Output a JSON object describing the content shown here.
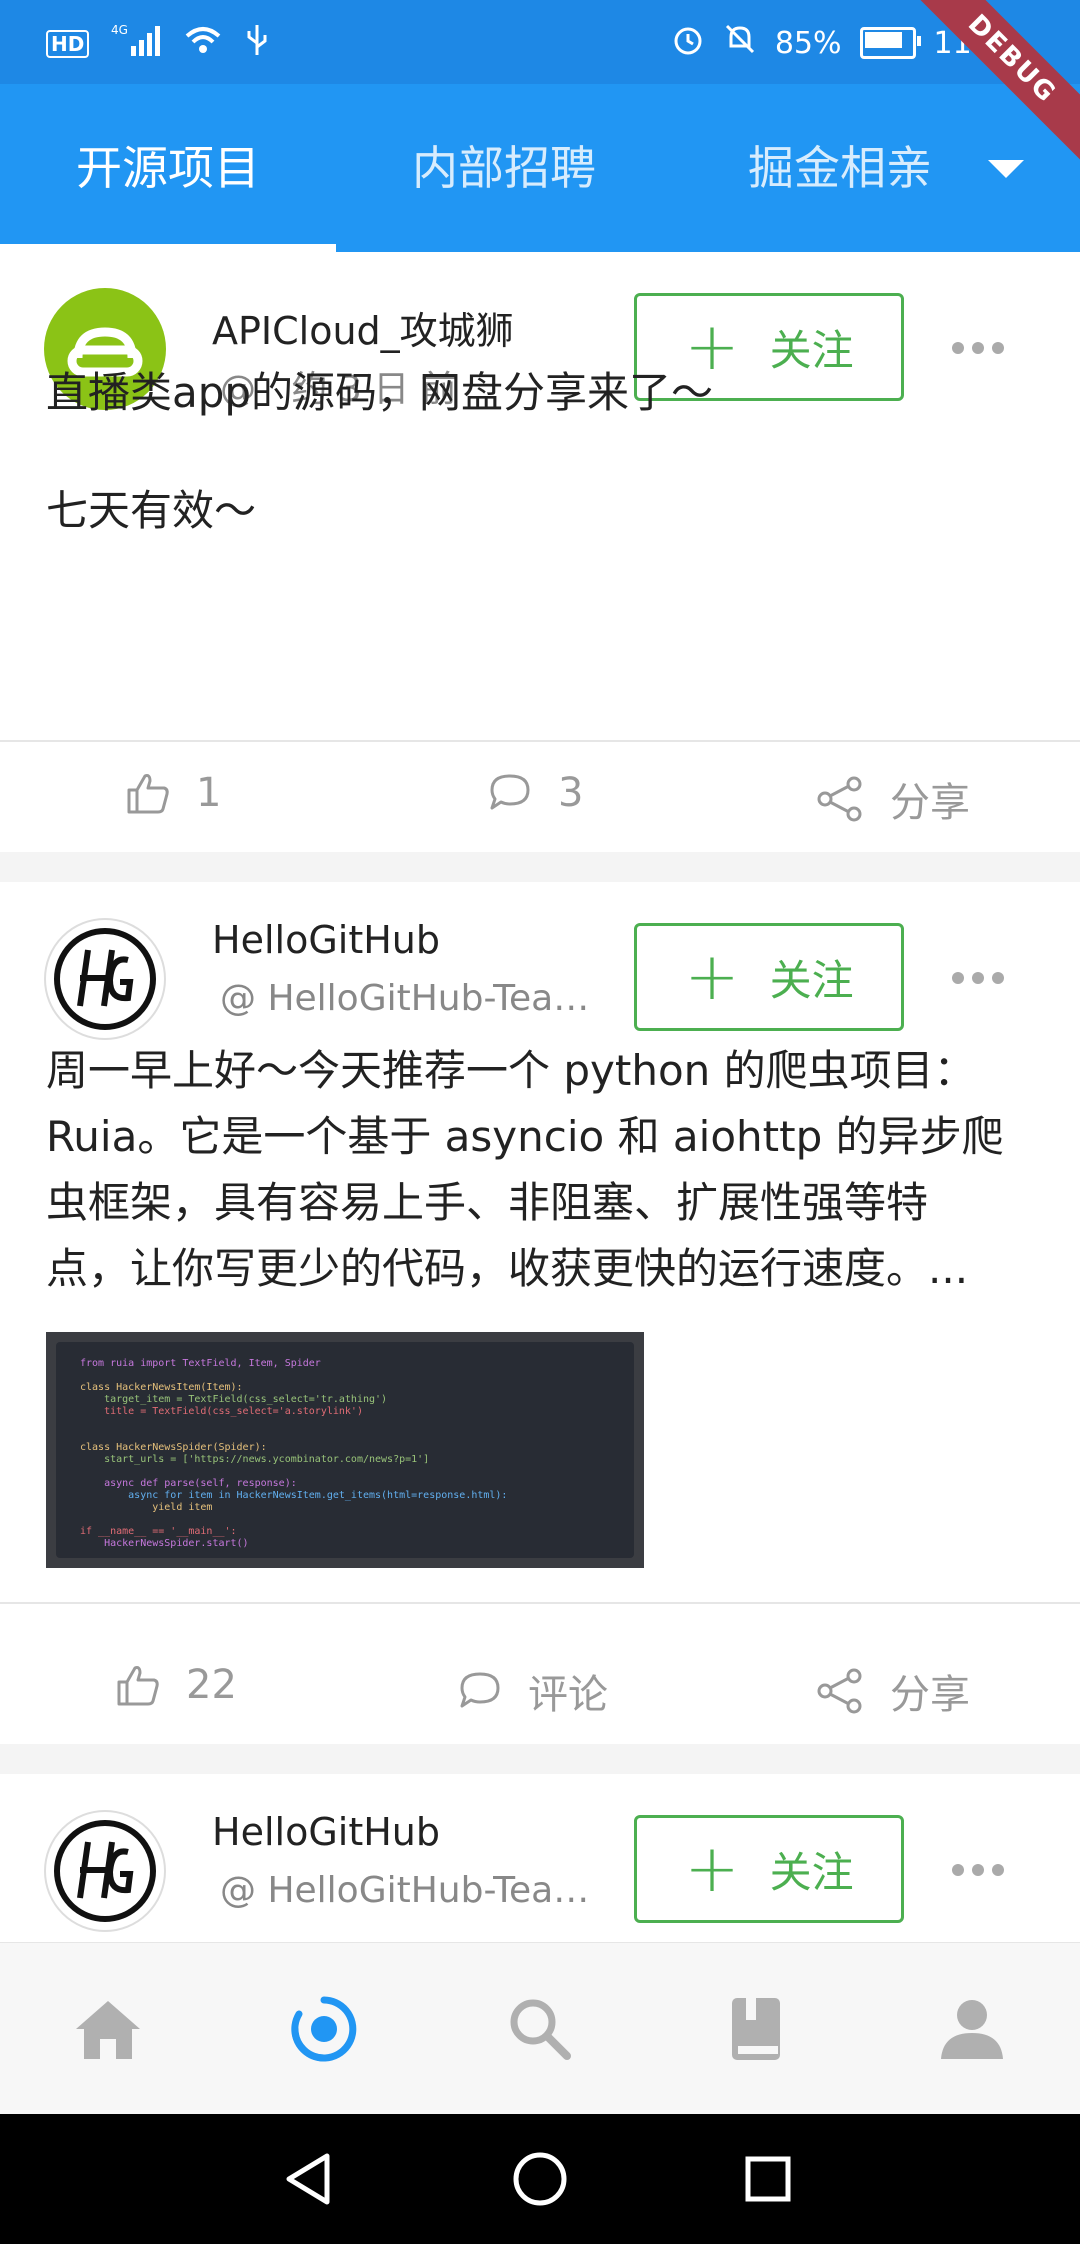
{
  "status_bar": {
    "hd_label": "HD",
    "network_label": "4G",
    "battery_percent": "85%",
    "battery_level": 0.85,
    "time": "11:21"
  },
  "debug_banner": "DEBUG",
  "tabs": [
    {
      "label": "开源项目",
      "active": true
    },
    {
      "label": "内部招聘",
      "active": false
    },
    {
      "label": "掘金相亲",
      "active": false
    }
  ],
  "posts": [
    {
      "author": "APICloud_攻城狮",
      "handle": "@",
      "time_ago": "约 3 日 前",
      "follow_label": "关注",
      "content_lines": [
        "直播类app的源码，网盘分享来了～",
        "",
        "七天有效～"
      ],
      "likes": "1",
      "comments": "3",
      "share_label": "分享"
    },
    {
      "author": "HelloGitHub",
      "handle": "@ HelloGitHub-Team...",
      "follow_label": "关注",
      "content_lines": [
        "周一早上好～今天推荐一个 python 的爬虫项目：",
        "Ruia。它是一个基于 asyncio 和 aiohttp 的异步爬",
        "虫框架，具有容易上手、非阻塞、扩展性强等特",
        "点，让你写更少的代码，收获更快的运行速度。..."
      ],
      "code_lines": [
        "from ruia import TextField, Item, Spider",
        "",
        "class HackerNewsItem(Item):",
        "    target_item = TextField(css_select='tr.athing')",
        "    title = TextField(css_select='a.storylink')",
        "",
        "",
        "class HackerNewsSpider(Spider):",
        "    start_urls = ['https://news.ycombinator.com/news?p=1']",
        "",
        "    async def parse(self, response):",
        "        async for item in HackerNewsItem.get_items(html=response.html):",
        "            yield item",
        "",
        "if __name__ == '__main__':",
        "    HackerNewsSpider.start()"
      ],
      "likes": "22",
      "comments": "评论",
      "share_label": "分享"
    },
    {
      "author": "HelloGitHub",
      "handle": "@ HelloGitHub-Team...",
      "follow_label": "关注"
    }
  ],
  "bottom_nav": [
    {
      "icon": "home-icon",
      "active": false
    },
    {
      "icon": "activity-icon",
      "active": true
    },
    {
      "icon": "search-icon",
      "active": false
    },
    {
      "icon": "book-icon",
      "active": false
    },
    {
      "icon": "profile-icon",
      "active": false
    }
  ],
  "colors": {
    "primary": "#2196f3",
    "status_bar": "#1e88e5",
    "follow_green": "#4caf50",
    "debug_red": "#a83a4a"
  }
}
